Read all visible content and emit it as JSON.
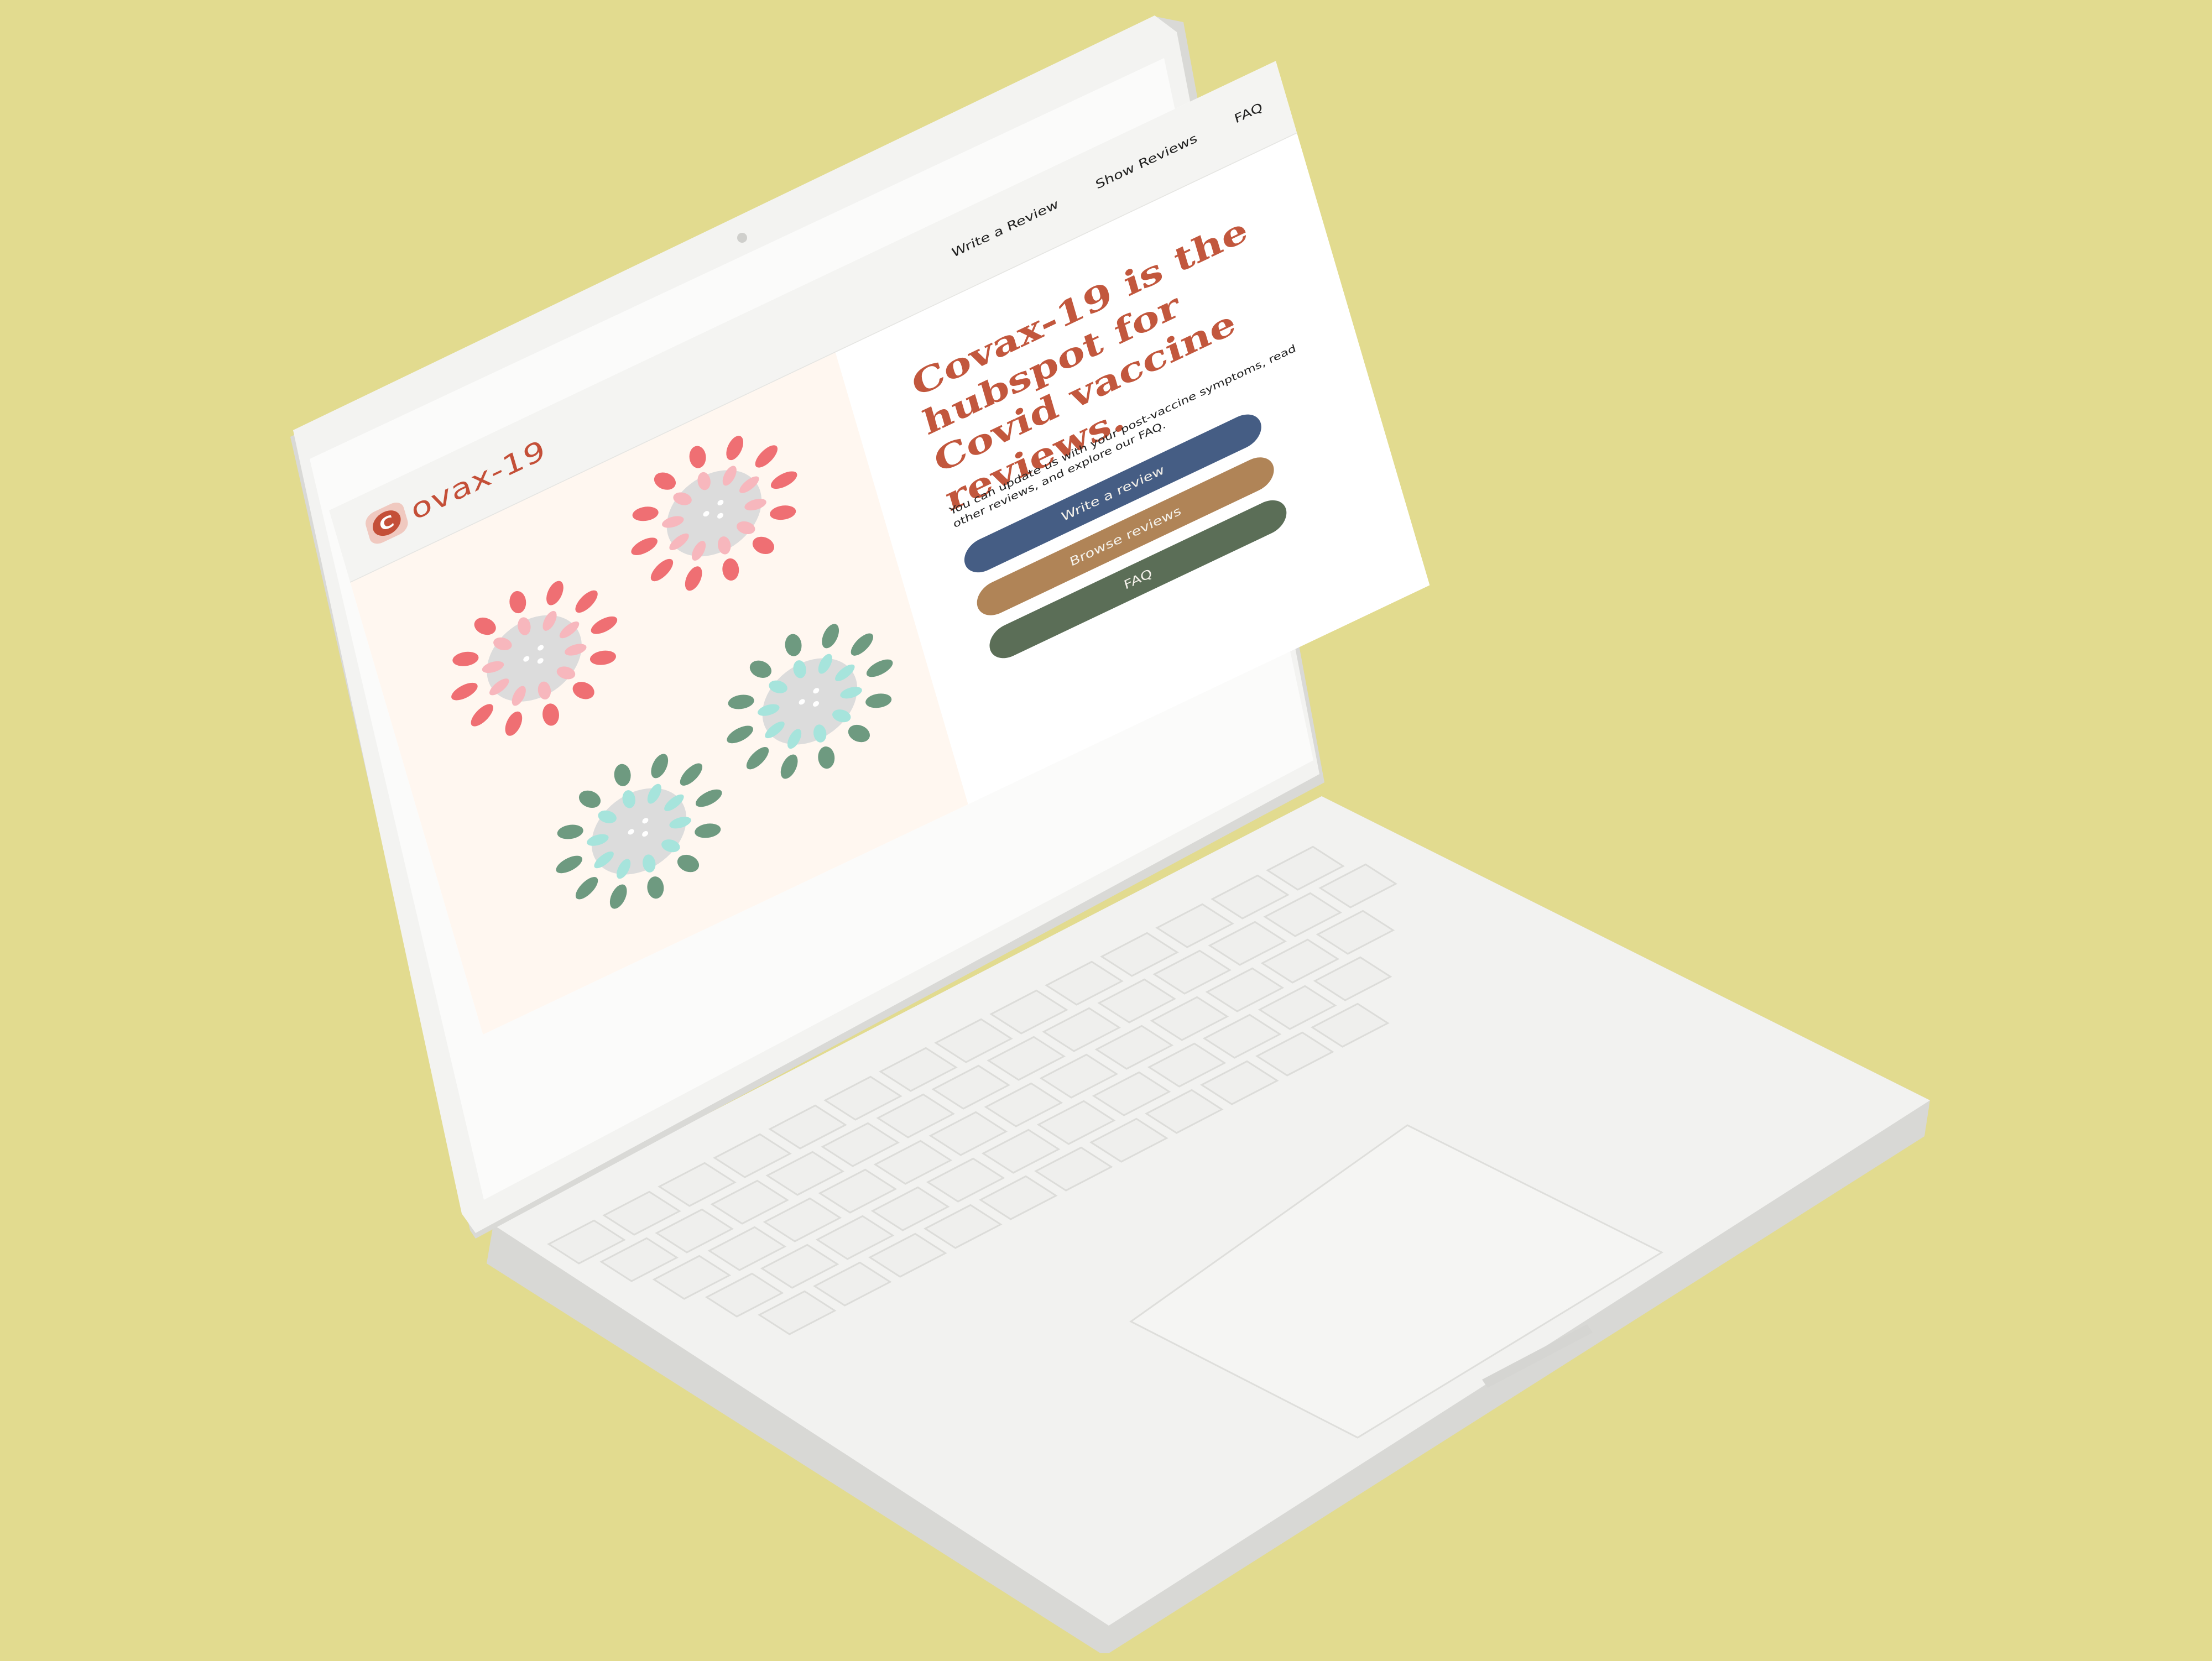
{
  "site": {
    "logo_text": "ovax-19",
    "logo_letter": "C",
    "nav": [
      "Write a Review",
      "Show Reviews",
      "FAQ"
    ],
    "headline": "Covax-19 is the hubspot for Covid vaccine reviews.",
    "subtext": "You can update us with your post-vaccine symptoms, read other reviews, and explore our FAQ.",
    "buttons": {
      "write": "Write a review",
      "browse": "Browse reviews",
      "faq": "FAQ"
    }
  },
  "colors": {
    "background": "#e2db8f",
    "brand": "#c44f38",
    "headline": "#c2573d",
    "button_write": "#455d84",
    "button_browse": "#b08457",
    "button_faq": "#5b6e57",
    "virus_red": "#ef6f73",
    "virus_pink": "#f7b7bd",
    "virus_green": "#6e9a80",
    "virus_teal": "#a6e4dc"
  },
  "icons": [
    "virus-icon-red-1",
    "virus-icon-red-2",
    "virus-icon-green-1",
    "virus-icon-green-2"
  ]
}
